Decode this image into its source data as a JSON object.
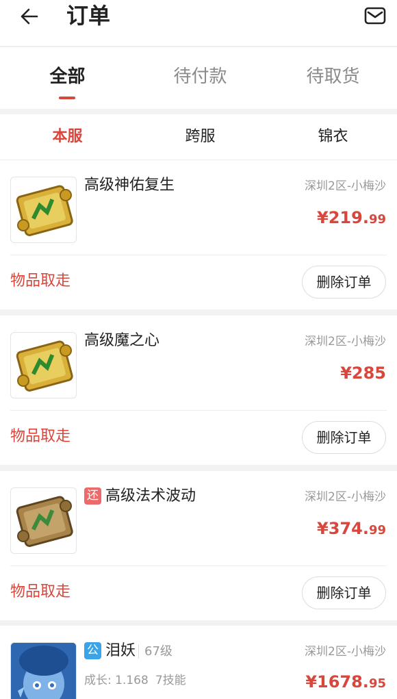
{
  "header": {
    "title": "订单"
  },
  "tabs": [
    {
      "label": "全部"
    },
    {
      "label": "待付款"
    },
    {
      "label": "待取货"
    }
  ],
  "subtabs": [
    {
      "label": "本服"
    },
    {
      "label": "跨服"
    },
    {
      "label": "锦衣"
    }
  ],
  "orders": [
    {
      "name": "高级神佑复生",
      "server": "深圳2区-小梅沙",
      "price_main": "¥219.",
      "price_cents": "99",
      "status": "物品取走",
      "button": "删除订单"
    },
    {
      "name": "高级魔之心",
      "server": "深圳2区-小梅沙",
      "price_main": "¥285",
      "price_cents": "",
      "status": "物品取走",
      "button": "删除订单"
    },
    {
      "tag": "还",
      "name": "高级法术波动",
      "server": "深圳2区-小梅沙",
      "price_main": "¥374.",
      "price_cents": "99",
      "status": "物品取走",
      "button": "删除订单"
    }
  ],
  "pet": {
    "tag": "公",
    "name": "泪妖",
    "level": "67级",
    "growth": "成长: 1.168",
    "skills": "7技能",
    "server": "深圳2区-小梅沙",
    "price_main": "¥1678.",
    "price_cents": "95"
  },
  "colors": {
    "accent": "#d9463b",
    "tag_red": "#ee6a6a",
    "tag_blue": "#3ba4e6"
  },
  "icons": {
    "back": "arrow-left-icon",
    "mail": "mail-icon",
    "scroll": "scroll-icon"
  }
}
